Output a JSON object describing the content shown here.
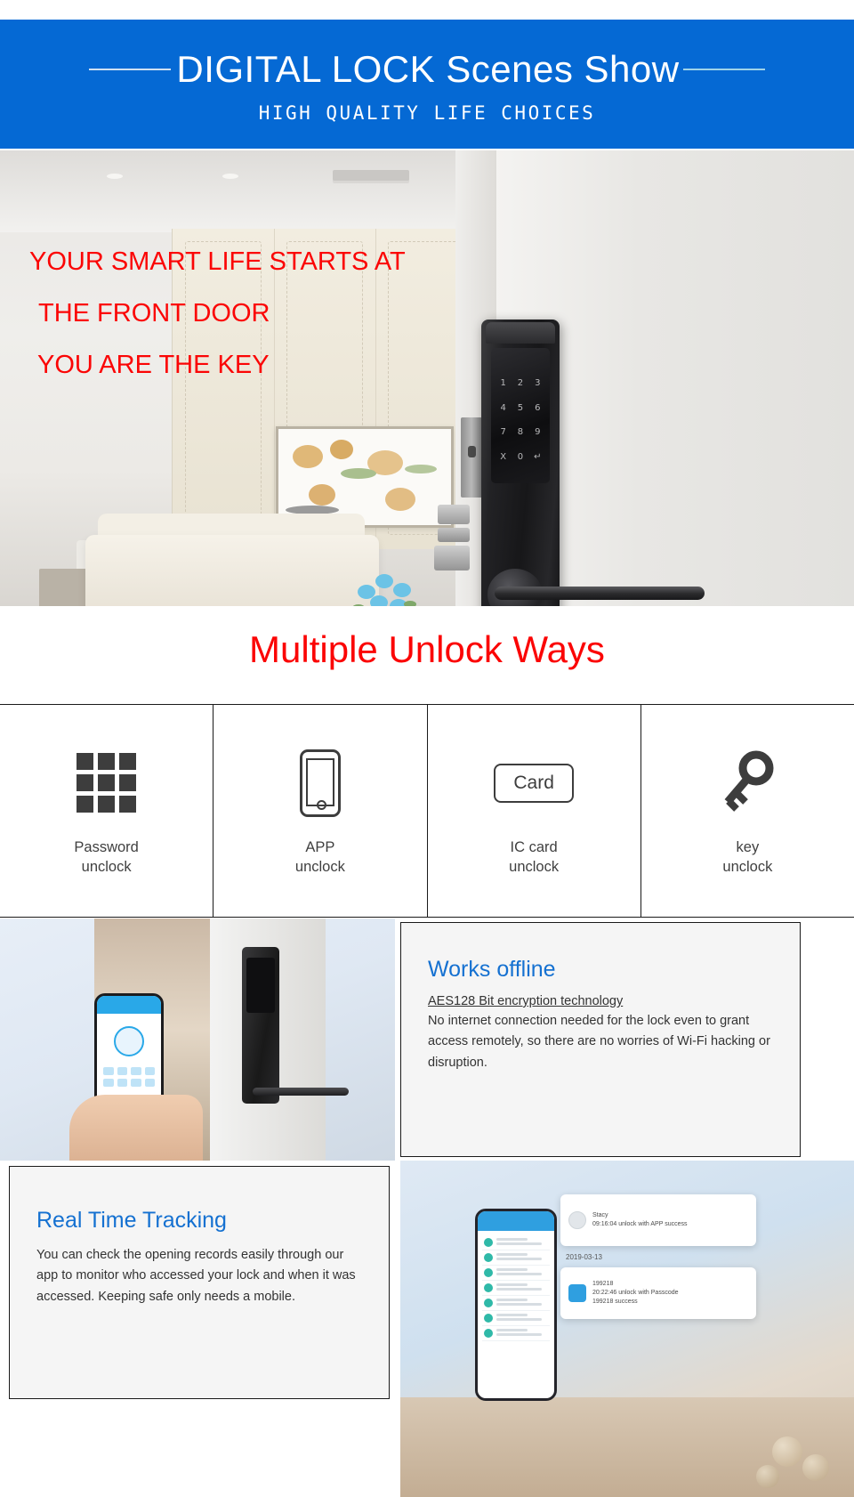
{
  "banner": {
    "title": "DIGITAL  LOCK Scenes  Show",
    "subtitle": "HIGH  QUALITY  LIFE  CHOICES",
    "bg_color": "#0569d4",
    "text_color": "#ffffff"
  },
  "hero": {
    "line1": "YOUR SMART LIFE STARTS AT",
    "line2": "THE FRONT DOOR",
    "line3": "YOU ARE THE KEY",
    "text_color": "#fb0505",
    "keypad_keys": [
      "1",
      "2",
      "3",
      "4",
      "5",
      "6",
      "7",
      "8",
      "9",
      "X",
      "0",
      "↵"
    ]
  },
  "section_title": {
    "text": "Multiple Unlock Ways",
    "color": "#fb0505"
  },
  "unlock_ways": [
    {
      "icon": "keypad-grid-icon",
      "label": "Password\nunclock"
    },
    {
      "icon": "smartphone-icon",
      "label": "APP\nunclock"
    },
    {
      "icon": "ic-card-icon",
      "card_text": "Card",
      "label": "IC card\nunclock"
    },
    {
      "icon": "key-icon",
      "label": "key\nunclock"
    }
  ],
  "features": {
    "offline": {
      "heading": "Works offline",
      "subheading": "AES128 Bit encryption technology",
      "body": "No internet connection needed for the lock even to grant access remotely, so there are no worries of Wi-Fi hacking or disruption.",
      "heading_color": "#1571d1"
    },
    "tracking": {
      "heading": "Real Time Tracking",
      "body": "You can check the opening records easily through our app to monitor who accessed your lock and when it was accessed. Keeping safe only needs a mobile.",
      "heading_color": "#1571d1"
    }
  },
  "app_records": {
    "user_name": "Stacy",
    "entry_1": "09:16:04 unlock with APP success",
    "date_divider": "2019-03-13",
    "passcode": "199218",
    "entry_2": "20:22:46 unlock with Passcode",
    "entry_2_line2": "199218 success"
  }
}
